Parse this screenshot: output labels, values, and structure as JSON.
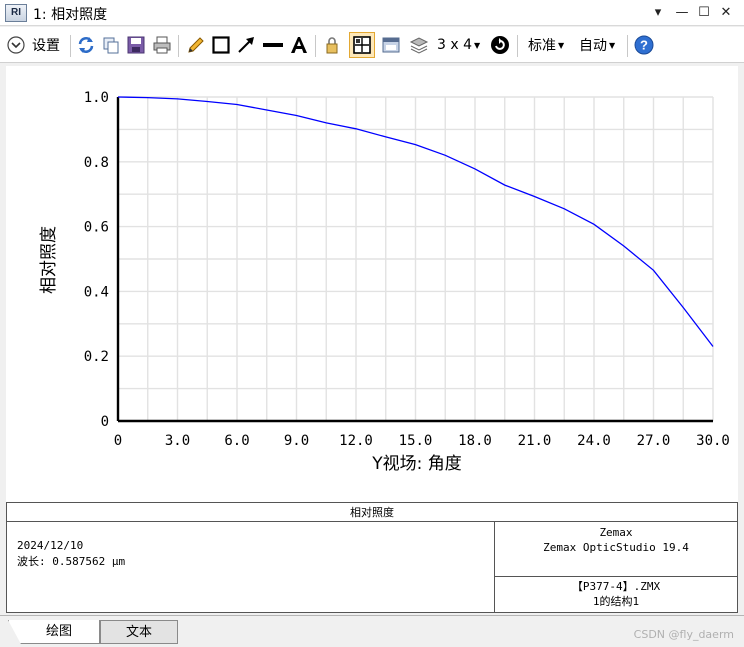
{
  "window": {
    "logo": "RI",
    "title": "1: 相对照度",
    "controls": [
      "▾",
      "—",
      "☐",
      "✕"
    ]
  },
  "toolbar": {
    "settings_label": "设置",
    "layout_label": "3 x 4",
    "standard_label": "标准",
    "auto_label": "自动",
    "icons": [
      "refresh-icon",
      "copy-icon",
      "save-icon",
      "print-icon",
      "pencil-icon",
      "rectangle-icon",
      "arrow-icon",
      "line-icon",
      "text-icon",
      "lock-icon",
      "grid-icon",
      "window-icon",
      "layers-icon",
      "rotate-icon",
      "help-icon"
    ],
    "accent": "#2d6cc8"
  },
  "chart_data": {
    "type": "line",
    "title": "",
    "xlabel": "Y视场: 角度",
    "ylabel": "相对照度",
    "xlim": [
      0,
      30
    ],
    "ylim": [
      0,
      1
    ],
    "x_ticks": [
      "0",
      "3.0",
      "6.0",
      "9.0",
      "12.0",
      "15.0",
      "18.0",
      "21.0",
      "24.0",
      "27.0",
      "30.0"
    ],
    "y_ticks": [
      "0",
      "0.2",
      "0.4",
      "0.6",
      "0.8",
      "1.0"
    ],
    "grid": true,
    "line_color": "#0000ff",
    "series": [
      {
        "x": [
          0,
          1.5,
          3,
          4.5,
          6,
          7.5,
          9,
          10.5,
          12,
          13.5,
          15,
          16.5,
          18,
          19.5,
          21,
          22.5,
          24,
          25.5,
          27,
          28.5,
          30
        ],
        "y": [
          1.0,
          0.998,
          0.994,
          0.986,
          0.977,
          0.96,
          0.943,
          0.92,
          0.902,
          0.877,
          0.853,
          0.82,
          0.778,
          0.728,
          0.693,
          0.655,
          0.607,
          0.54,
          0.465,
          0.35,
          0.23
        ]
      }
    ]
  },
  "info": {
    "header": "相对照度",
    "date": "2024/12/10",
    "wavelength": "波长: 0.587562 µm",
    "software_line1": "Zemax",
    "software_line2": "Zemax OpticStudio 19.4",
    "file_line1": "【P377-4】.ZMX",
    "file_line2": "1的结构1"
  },
  "tabs": {
    "tab_draw": "绘图",
    "tab_text": "文本",
    "watermark": "CSDN @fly_daerm"
  }
}
